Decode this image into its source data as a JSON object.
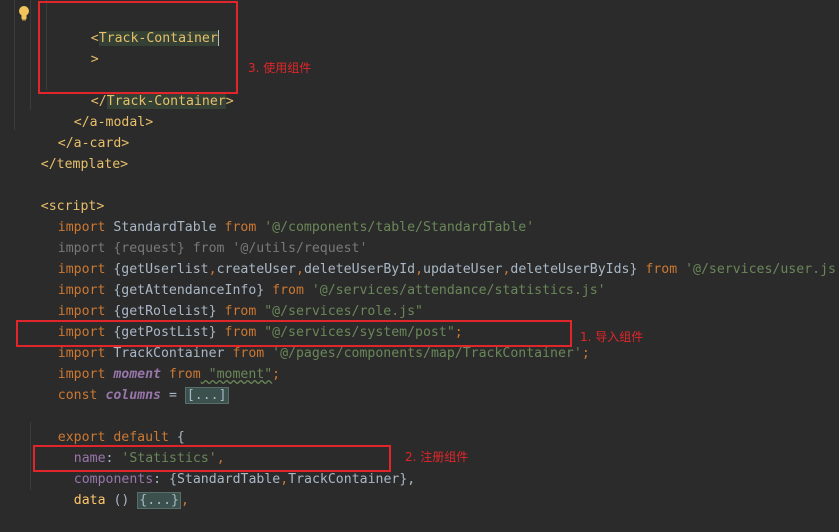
{
  "lines": {
    "l1_open": "<",
    "l1_name": "Track-Container",
    "l2": ">",
    "l4_open": "</",
    "l4_name": "Track-Container",
    "l4_close": ">",
    "l5": "</a-modal>",
    "l6": "</a-card>",
    "l7": "</template>",
    "l9": "<script>",
    "l10_kw": "import",
    "l10_name": " StandardTable ",
    "l10_from": "from",
    "l10_str": " '@/components/table/StandardTable'",
    "l11": "import {request} from '@/utils/request'",
    "l12_kw": "import",
    "l12_body": " {getUserlist",
    "l12_c1": ",",
    "l12_b2": "createUser",
    "l12_c2": ",",
    "l12_b3": "deleteUserById",
    "l12_c3": ",",
    "l12_b4": "updateUser",
    "l12_c4": ",",
    "l12_b5": "deleteUserByIds}",
    "l12_from": " from",
    "l12_str": " '@/services/user.js'",
    "l13_kw": "import",
    "l13_body": " {getAttendanceInfo}",
    "l13_from": " from",
    "l13_str": " '@/services/attendance/statistics.js'",
    "l14_kw": "import",
    "l14_body": " {getRolelist}",
    "l14_from": " from",
    "l14_str": " \"@/services/role.js\"",
    "l15_kw": "import",
    "l15_body": " {getPostList}",
    "l15_from": " from",
    "l15_str": " \"@/services/system/post\"",
    "l15_semi": ";",
    "l16_kw": "import",
    "l16_body": " TrackContainer ",
    "l16_from": "from",
    "l16_str": " '@/pages/components/map/TrackContainer'",
    "l16_semi": ";",
    "l17_kw": "import",
    "l17_body": " moment",
    "l17_from": " from",
    "l17_str": " \"moment\"",
    "l17_semi": ";",
    "l18_kw": "const",
    "l18_body": " columns",
    "l18_eq": " = ",
    "l18_fold": "[...]",
    "l20_kw": "export default",
    "l20_body": " {",
    "l21_field": "name",
    "l21_colon": ": ",
    "l21_str": "'Statistics'",
    "l21_comma": ",",
    "l22_field": "components",
    "l22_body": ": {StandardTable",
    "l22_c": ",",
    "l22_b2": "TrackContainer},",
    "l23_fn": "data",
    "l23_body": " () ",
    "l23_fold": "{...}",
    "l23_comma": ","
  },
  "annotations": {
    "use": "3. 使用组件",
    "import": "1. 导入组件",
    "register": "2. 注册组件"
  },
  "colors": {
    "background": "#2b2b2b",
    "annotation": "#e0262a"
  },
  "icons": {
    "bulb": "lightbulb-icon"
  }
}
